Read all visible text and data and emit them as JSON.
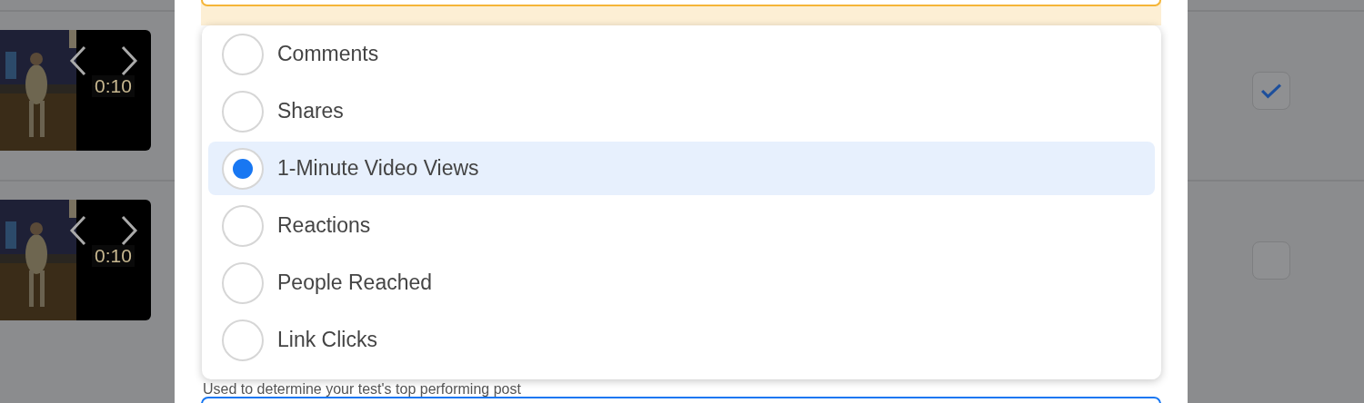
{
  "posts": [
    {
      "duration": "0:10",
      "checked": true
    },
    {
      "duration": "0:10",
      "checked": false
    }
  ],
  "metric_options": [
    {
      "label": "Comments",
      "selected": false
    },
    {
      "label": "Shares",
      "selected": false
    },
    {
      "label": "1-Minute Video Views",
      "selected": true
    },
    {
      "label": "Reactions",
      "selected": false
    },
    {
      "label": "People Reached",
      "selected": false
    },
    {
      "label": "Link Clicks",
      "selected": false
    }
  ],
  "helper_text": "Used to determine your test's top performing post"
}
